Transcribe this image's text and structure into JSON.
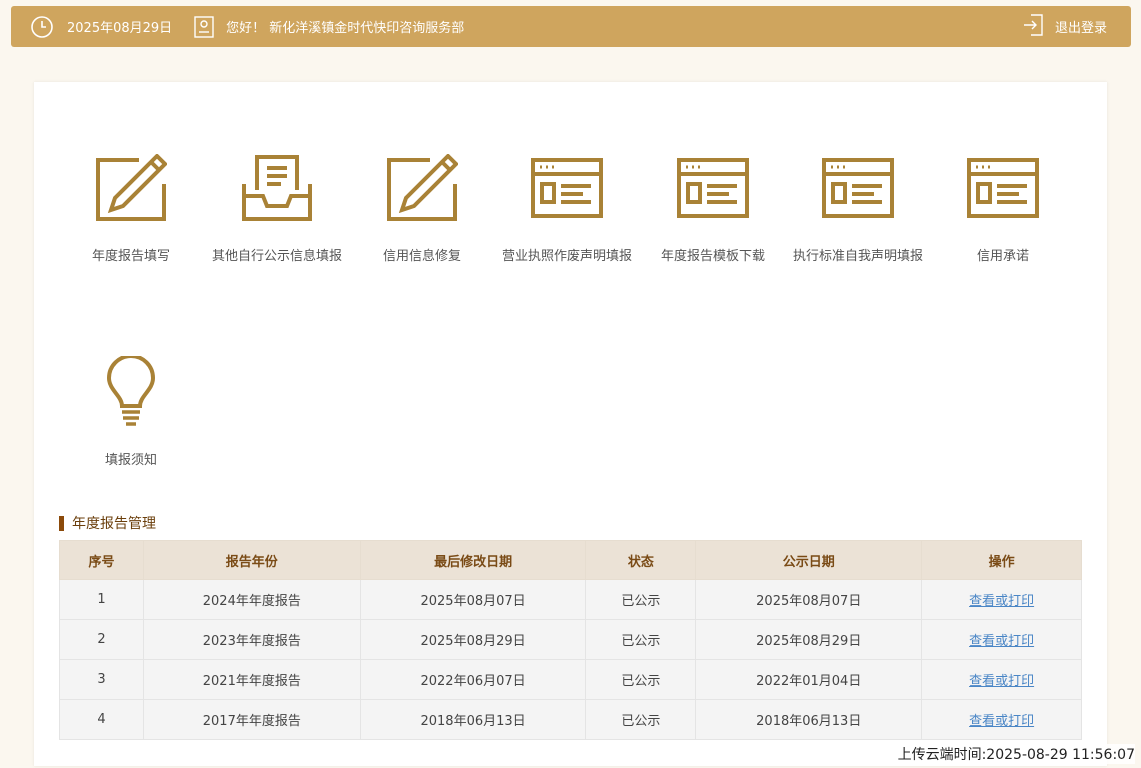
{
  "header": {
    "date": "2025年08月29日",
    "greeting": "您好！ 新化洋溪镇金时代快印咨询服务部",
    "logout_label": "退出登录"
  },
  "menu": [
    {
      "label": "年度报告填写",
      "icon": "edit-pencil-icon"
    },
    {
      "label": "其他自行公示信息填报",
      "icon": "inbox-document-icon"
    },
    {
      "label": "信用信息修复",
      "icon": "edit-pencil-icon"
    },
    {
      "label": "营业执照作废声明填报",
      "icon": "browser-window-icon"
    },
    {
      "label": "年度报告模板下载",
      "icon": "browser-window-icon"
    },
    {
      "label": "执行标准自我声明填报",
      "icon": "browser-window-icon"
    },
    {
      "label": "信用承诺",
      "icon": "browser-window-icon"
    },
    {
      "label": "填报须知",
      "icon": "lightbulb-icon"
    }
  ],
  "section": {
    "title": "年度报告管理"
  },
  "table": {
    "headers": [
      "序号",
      "报告年份",
      "最后修改日期",
      "状态",
      "公示日期",
      "操作"
    ],
    "rows": [
      [
        "1",
        "2024年年度报告",
        "2025年08月07日",
        "已公示",
        "2025年08月07日",
        "查看或打印"
      ],
      [
        "2",
        "2023年年度报告",
        "2025年08月29日",
        "已公示",
        "2025年08月29日",
        "查看或打印"
      ],
      [
        "3",
        "2021年年度报告",
        "2022年06月07日",
        "已公示",
        "2022年01月04日",
        "查看或打印"
      ],
      [
        "4",
        "2017年年度报告",
        "2018年06月13日",
        "已公示",
        "2018年06月13日",
        "查看或打印"
      ]
    ]
  },
  "watermark": "上传云端时间:2025-08-29 11:56:07",
  "colors": {
    "accent": "#cfa55e",
    "icon": "#a98236",
    "link": "#4a86c6"
  }
}
